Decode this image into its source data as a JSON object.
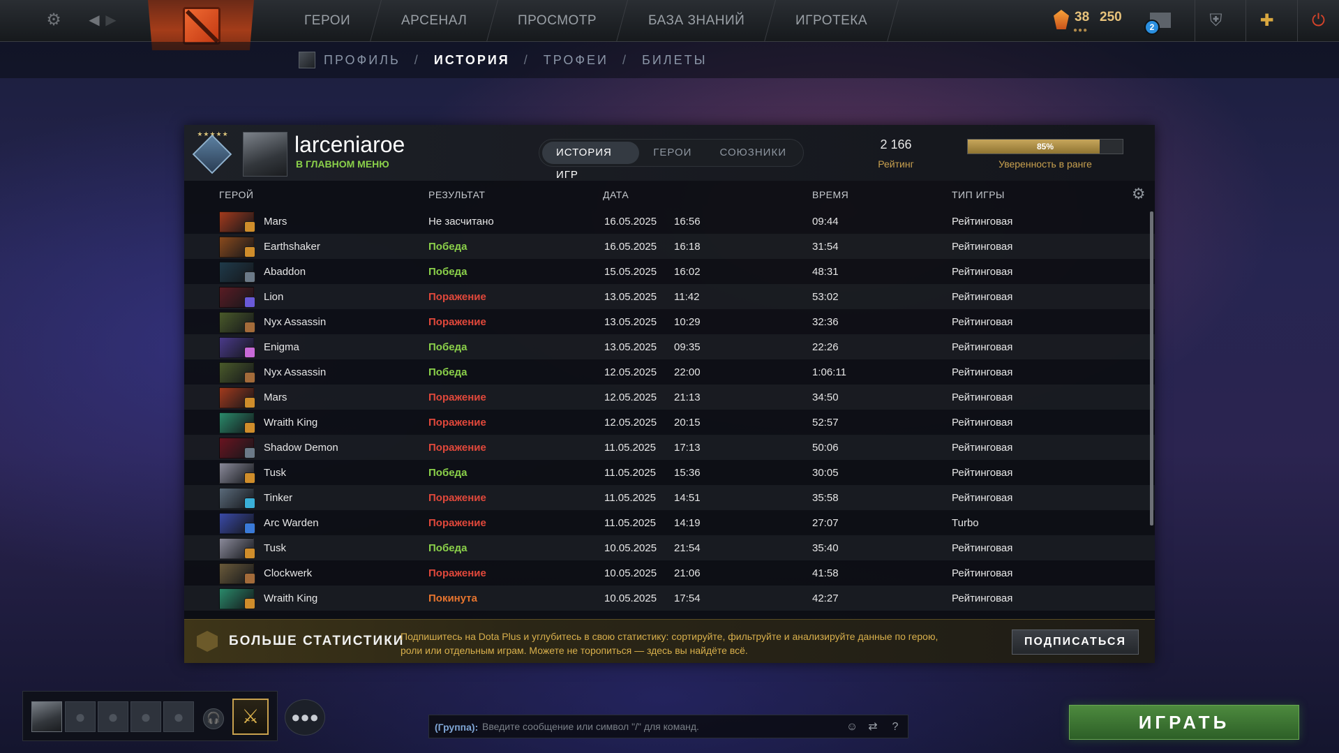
{
  "topbar": {
    "nav": [
      "ГЕРОИ",
      "АРСЕНАЛ",
      "ПРОСМОТР",
      "БАЗА ЗНАНИЙ",
      "ИГРОТЕКА"
    ],
    "currency_a": "38",
    "currency_b": "250",
    "mail_count": "2",
    "icons": {
      "settings": "gear-icon",
      "back": "chevron-left-icon",
      "forward": "chevron-right-icon",
      "logo": "dota-logo",
      "shards": "shard-icon",
      "mail": "mail-icon",
      "armory": "armor-icon",
      "plus": "dota-plus-icon",
      "power": "power-icon"
    }
  },
  "subnav": {
    "items": [
      "ПРОФИЛЬ",
      "ИСТОРИЯ",
      "ТРОФЕИ",
      "БИЛЕТЫ"
    ],
    "active": "ИСТОРИЯ",
    "separator": "/"
  },
  "profile": {
    "username": "larceniaroe",
    "status": "В ГЛАВНОМ МЕНЮ",
    "tabs": [
      "ИСТОРИЯ ИГР",
      "ГЕРОИ",
      "СОЮЗНИКИ"
    ],
    "rating_value": "2 166",
    "rating_label": "Рейтинг",
    "confidence_percent": "85%",
    "confidence_fraction": 0.85,
    "confidence_label": "Уверенность в ранге"
  },
  "table": {
    "headers": {
      "hero": "ГЕРОЙ",
      "result": "РЕЗУЛЬТАТ",
      "date": "ДАТА",
      "time": "ВРЕМЯ",
      "game_type": "ТИП ИГРЫ"
    },
    "rows": [
      {
        "hero": "Mars",
        "result": "Не засчитано",
        "result_kind": "none",
        "date": "16.05.2025",
        "clock": "16:56",
        "duration": "09:44",
        "type": "Рейтинговая",
        "color": "#a33a1c",
        "role_color": "#cf8d2b"
      },
      {
        "hero": "Earthshaker",
        "result": "Победа",
        "result_kind": "win",
        "date": "16.05.2025",
        "clock": "16:18",
        "duration": "31:54",
        "type": "Рейтинговая",
        "color": "#8a4a1c",
        "role_color": "#cf8d2b"
      },
      {
        "hero": "Abaddon",
        "result": "Победа",
        "result_kind": "win",
        "date": "15.05.2025",
        "clock": "16:02",
        "duration": "48:31",
        "type": "Рейтинговая",
        "color": "#1f3a4a",
        "role_color": "#6c7a88"
      },
      {
        "hero": "Lion",
        "result": "Поражение",
        "result_kind": "loss",
        "date": "13.05.2025",
        "clock": "11:42",
        "duration": "53:02",
        "type": "Рейтинговая",
        "color": "#5a1c24",
        "role_color": "#6a5ad8"
      },
      {
        "hero": "Nyx Assassin",
        "result": "Поражение",
        "result_kind": "loss",
        "date": "13.05.2025",
        "clock": "10:29",
        "duration": "32:36",
        "type": "Рейтинговая",
        "color": "#4a5a2a",
        "role_color": "#a36b3a"
      },
      {
        "hero": "Enigma",
        "result": "Победа",
        "result_kind": "win",
        "date": "13.05.2025",
        "clock": "09:35",
        "duration": "22:26",
        "type": "Рейтинговая",
        "color": "#4a3a8a",
        "role_color": "#c86ad8"
      },
      {
        "hero": "Nyx Assassin",
        "result": "Победа",
        "result_kind": "win",
        "date": "12.05.2025",
        "clock": "22:00",
        "duration": "1:06:11",
        "type": "Рейтинговая",
        "color": "#4a5a2a",
        "role_color": "#a36b3a"
      },
      {
        "hero": "Mars",
        "result": "Поражение",
        "result_kind": "loss",
        "date": "12.05.2025",
        "clock": "21:13",
        "duration": "34:50",
        "type": "Рейтинговая",
        "color": "#a33a1c",
        "role_color": "#cf8d2b"
      },
      {
        "hero": "Wraith King",
        "result": "Поражение",
        "result_kind": "loss",
        "date": "12.05.2025",
        "clock": "20:15",
        "duration": "52:57",
        "type": "Рейтинговая",
        "color": "#2a8a6a",
        "role_color": "#cf8d2b"
      },
      {
        "hero": "Shadow Demon",
        "result": "Поражение",
        "result_kind": "loss",
        "date": "11.05.2025",
        "clock": "17:13",
        "duration": "50:06",
        "type": "Рейтинговая",
        "color": "#6a1420",
        "role_color": "#6c7a88"
      },
      {
        "hero": "Tusk",
        "result": "Победа",
        "result_kind": "win",
        "date": "11.05.2025",
        "clock": "15:36",
        "duration": "30:05",
        "type": "Рейтинговая",
        "color": "#8a8a9a",
        "role_color": "#cf8d2b"
      },
      {
        "hero": "Tinker",
        "result": "Поражение",
        "result_kind": "loss",
        "date": "11.05.2025",
        "clock": "14:51",
        "duration": "35:58",
        "type": "Рейтинговая",
        "color": "#5a6a7a",
        "role_color": "#3ab0d8"
      },
      {
        "hero": "Arc Warden",
        "result": "Поражение",
        "result_kind": "loss",
        "date": "11.05.2025",
        "clock": "14:19",
        "duration": "27:07",
        "type": "Turbo",
        "color": "#3a4aa8",
        "role_color": "#3a7ad8"
      },
      {
        "hero": "Tusk",
        "result": "Победа",
        "result_kind": "win",
        "date": "10.05.2025",
        "clock": "21:54",
        "duration": "35:40",
        "type": "Рейтинговая",
        "color": "#8a8a9a",
        "role_color": "#cf8d2b"
      },
      {
        "hero": "Clockwerk",
        "result": "Поражение",
        "result_kind": "loss",
        "date": "10.05.2025",
        "clock": "21:06",
        "duration": "41:58",
        "type": "Рейтинговая",
        "color": "#6a5a3a",
        "role_color": "#a36b3a"
      },
      {
        "hero": "Wraith King",
        "result": "Покинута",
        "result_kind": "left",
        "date": "10.05.2025",
        "clock": "17:54",
        "duration": "42:27",
        "type": "Рейтинговая",
        "color": "#2a8a6a",
        "role_color": "#cf8d2b"
      }
    ]
  },
  "promo": {
    "title": "БОЛЬШЕ СТАТИСТИКИ",
    "text": "Подпишитесь на Dota Plus и углубитесь в свою статистику: сортируйте, фильтруйте и анализируйте данные по герою, роли или отдельным играм. Можете не торопиться — здесь вы найдёте всё.",
    "button": "ПОДПИСАТЬСЯ"
  },
  "chat": {
    "group_label": "(Группа):",
    "placeholder": "Введите сообщение или символ \"/\" для команд."
  },
  "play_button": "ИГРАТЬ",
  "colors": {
    "win": "#8bd14a",
    "loss": "#e0483b",
    "left": "#e6742e",
    "accent_gold": "#c9a14f"
  }
}
